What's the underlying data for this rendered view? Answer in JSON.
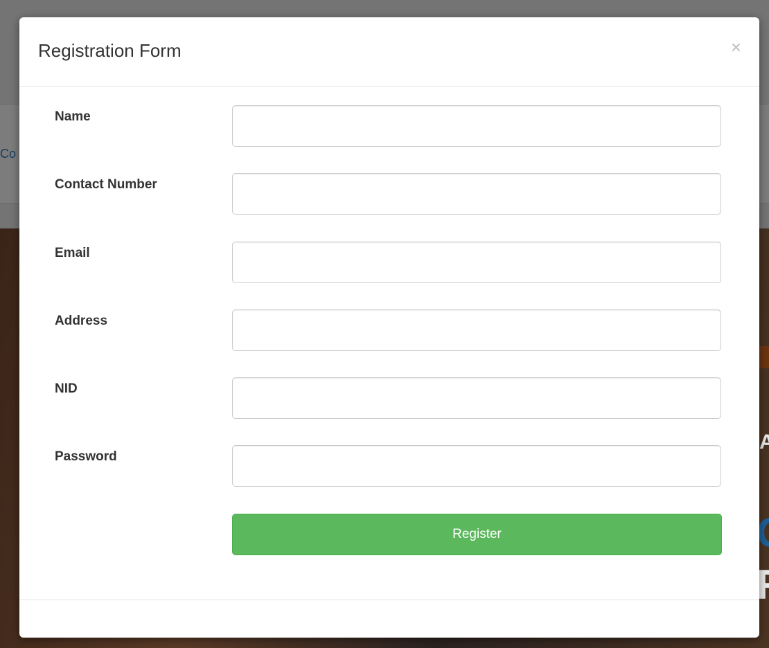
{
  "background": {
    "nav_link_fragment": "Co",
    "hero_fragments": [
      "A",
      "C",
      "R"
    ]
  },
  "modal": {
    "title": "Registration Form",
    "close_symbol": "×",
    "fields": [
      {
        "label": "Name",
        "value": "",
        "placeholder": ""
      },
      {
        "label": "Contact Number",
        "value": "",
        "placeholder": ""
      },
      {
        "label": "Email",
        "value": "",
        "placeholder": ""
      },
      {
        "label": "Address",
        "value": "",
        "placeholder": ""
      },
      {
        "label": "NID",
        "value": "",
        "placeholder": ""
      },
      {
        "label": "Password",
        "value": "",
        "placeholder": ""
      }
    ],
    "submit_label": "Register"
  },
  "colors": {
    "primary_success": "#5cb85c",
    "overlay": "#747474"
  },
  "icons": {
    "close": "close-icon"
  }
}
